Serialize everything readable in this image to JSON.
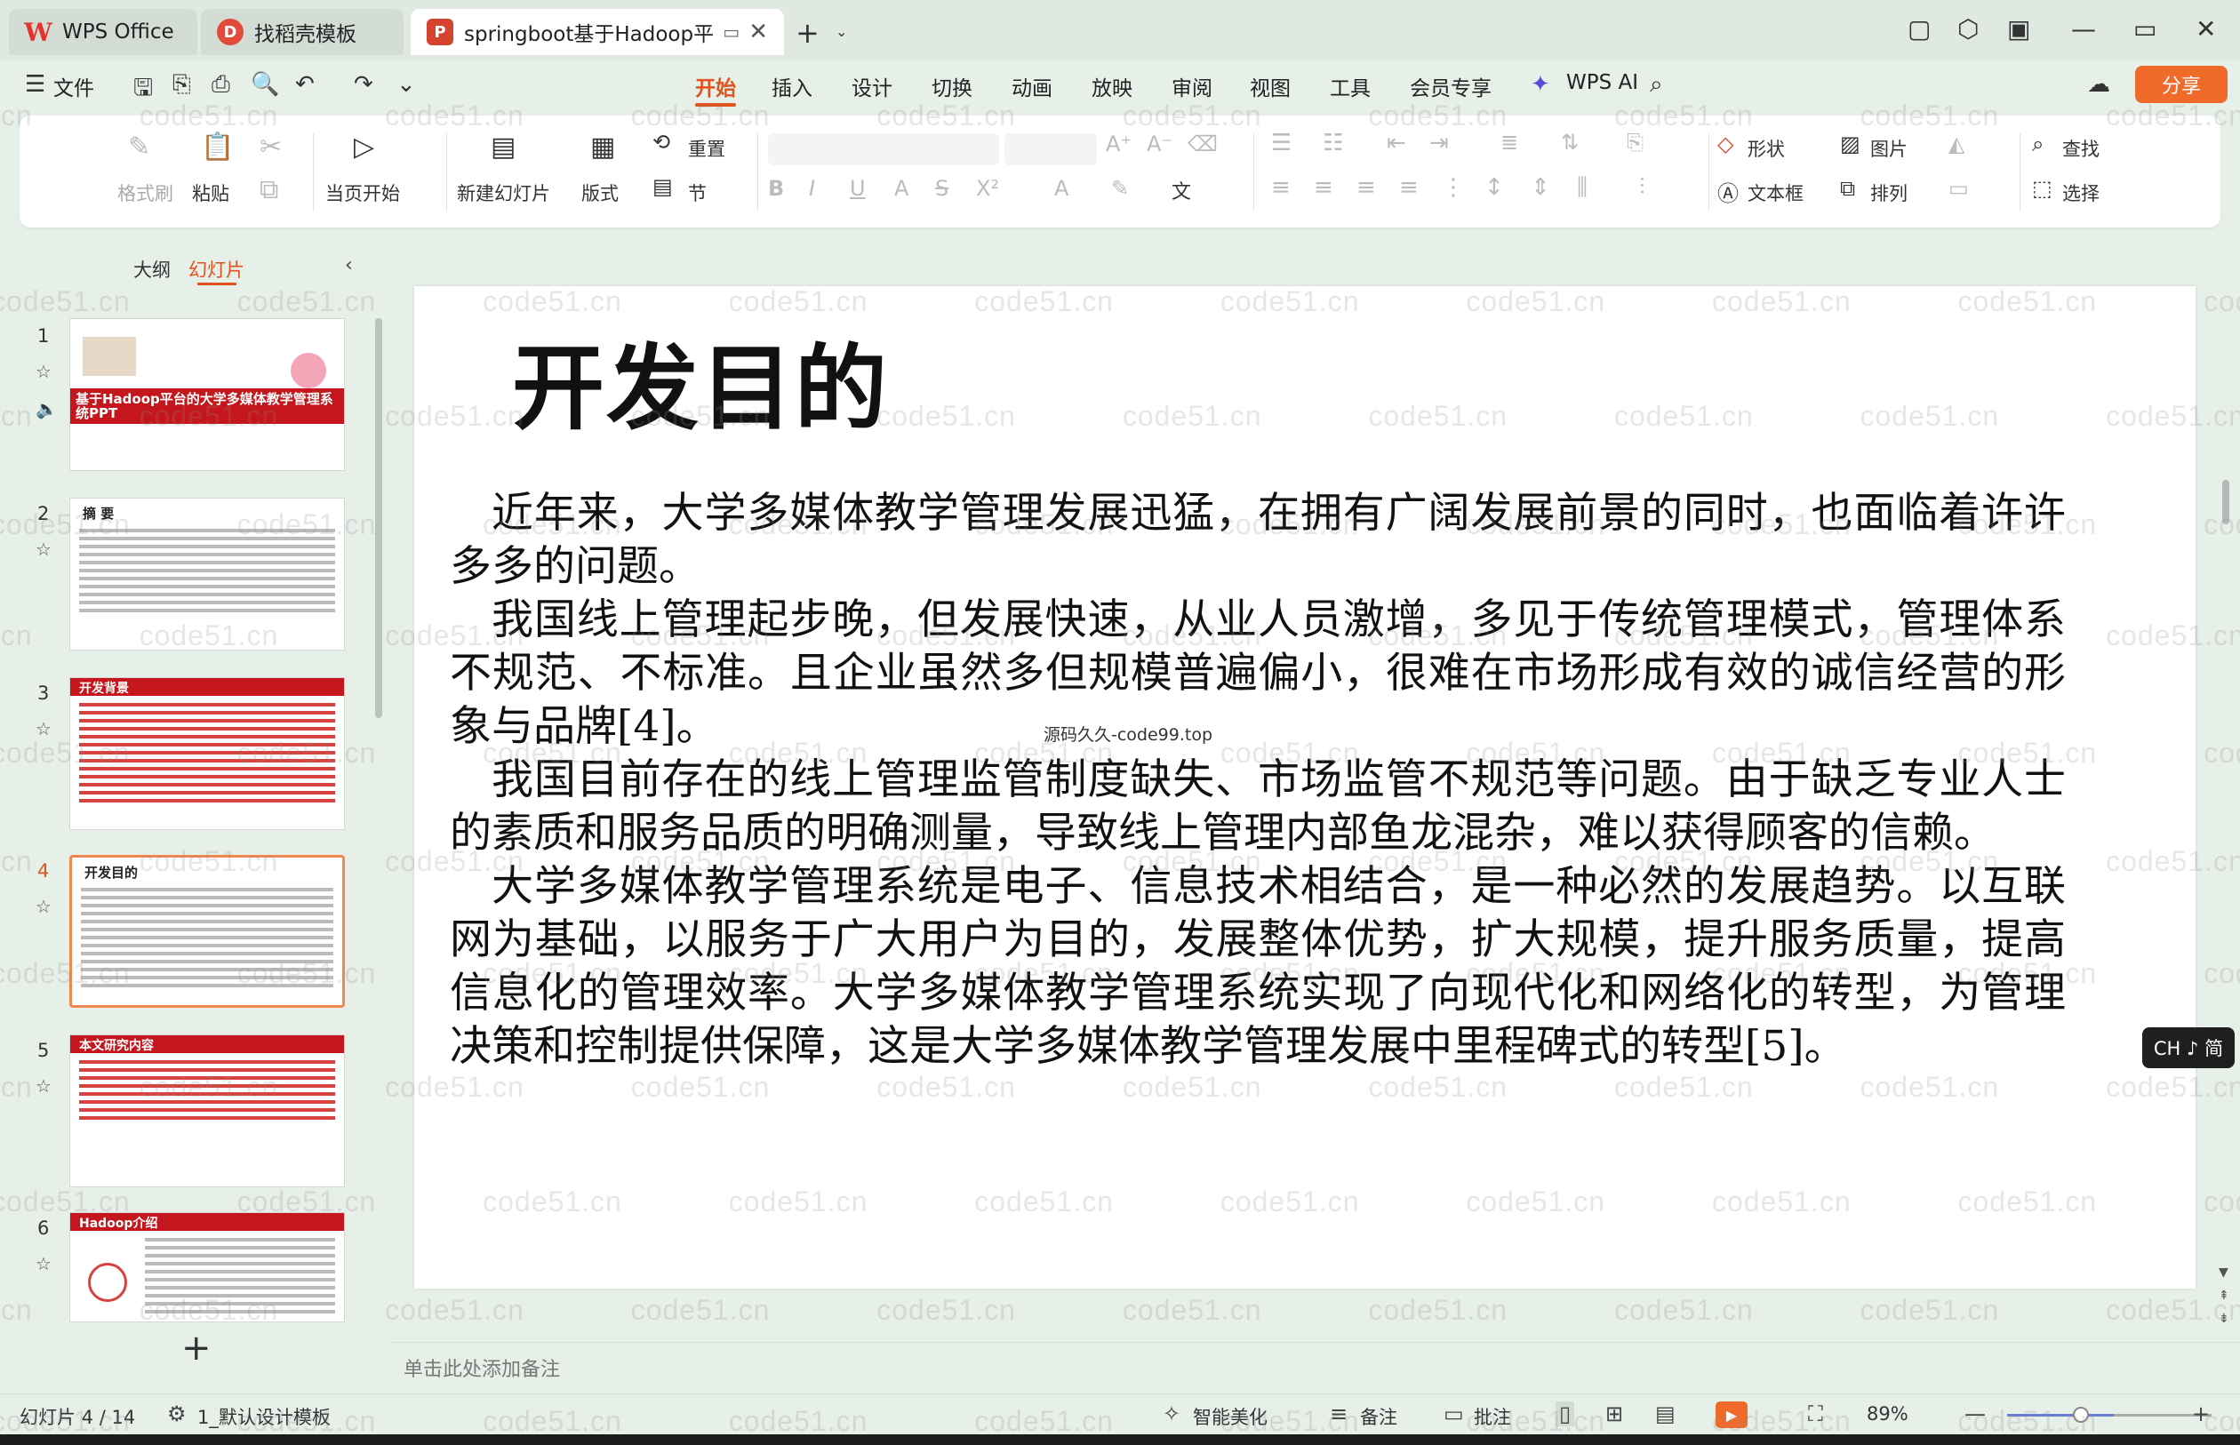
{
  "tabs": {
    "wps_office": "WPS Office",
    "template": "找稻壳模板",
    "document": "springboot基于Hadoop平台的"
  },
  "menu": {
    "file": "文件",
    "start": "开始",
    "insert": "插入",
    "design": "设计",
    "transition": "切换",
    "animation": "动画",
    "slideshow": "放映",
    "review": "审阅",
    "view": "视图",
    "tools": "工具",
    "member": "会员专享",
    "wps_ai": "WPS AI",
    "share": "分享"
  },
  "ribbon": {
    "format_painter": "格式刷",
    "paste": "粘贴",
    "from_current": "当页开始",
    "new_slide": "新建幻灯片",
    "layout": "版式",
    "section": "节",
    "reset": "重置",
    "shape": "形状",
    "picture": "图片",
    "find": "查找",
    "textbox": "文本框",
    "arrange": "排列",
    "select": "选择"
  },
  "left_panel": {
    "outline_tab": "大纲",
    "slides_tab": "幻灯片",
    "thumbnails": [
      {
        "num": "1",
        "title": "基于Hadoop平台的大学多媒体教学管理系统PPT"
      },
      {
        "num": "2",
        "title": "摘 要"
      },
      {
        "num": "3",
        "title": "开发背景"
      },
      {
        "num": "4",
        "title": "开发目的"
      },
      {
        "num": "5",
        "title": "本文研究内容"
      },
      {
        "num": "6",
        "title": "Hadoop介绍"
      }
    ]
  },
  "slide": {
    "title": "开发目的",
    "paragraphs": [
      "近年来，大学多媒体教学管理发展迅猛，在拥有广阔发展前景的同时，也面临着许许多多的问题。",
      "我国线上管理起步晚，但发展快速，从业人员激增，多见于传统管理模式，管理体系不规范、不标准。且企业虽然多但规模普遍偏小，很难在市场形成有效的诚信经营的形象与品牌[4]。",
      "我国目前存在的线上管理监管制度缺失、市场监管不规范等问题。由于缺乏专业人士的素质和服务品质的明确测量，导致线上管理内部鱼龙混杂，难以获得顾客的信赖。",
      "大学多媒体教学管理系统是电子、信息技术相结合，是一种必然的发展趋势。以互联网为基础，以服务于广大用户为目的，发展整体优势，扩大规模，提升服务质量，提高信息化的管理效率。大学多媒体教学管理系统实现了向现代化和网络化的转型，为管理决策和控制提供保障，这是大学多媒体教学管理发展中里程碑式的转型[5]。"
    ],
    "overlay_text": "源码久久-code99.top"
  },
  "notes_placeholder": "单击此处添加备注",
  "ime": "CH ♪ 简",
  "status": {
    "slide_counter": "幻灯片 4 / 14",
    "theme": "1_默认设计模板",
    "beautify": "智能美化",
    "notes": "备注",
    "comment": "批注",
    "zoom": "89%",
    "zoom_level": 0.89
  },
  "watermark": "code51.cn",
  "colors": {
    "accent": "#e0531e",
    "share": "#f06a2a",
    "thumb_band": "#c4161c",
    "background": "#e6efe8"
  }
}
